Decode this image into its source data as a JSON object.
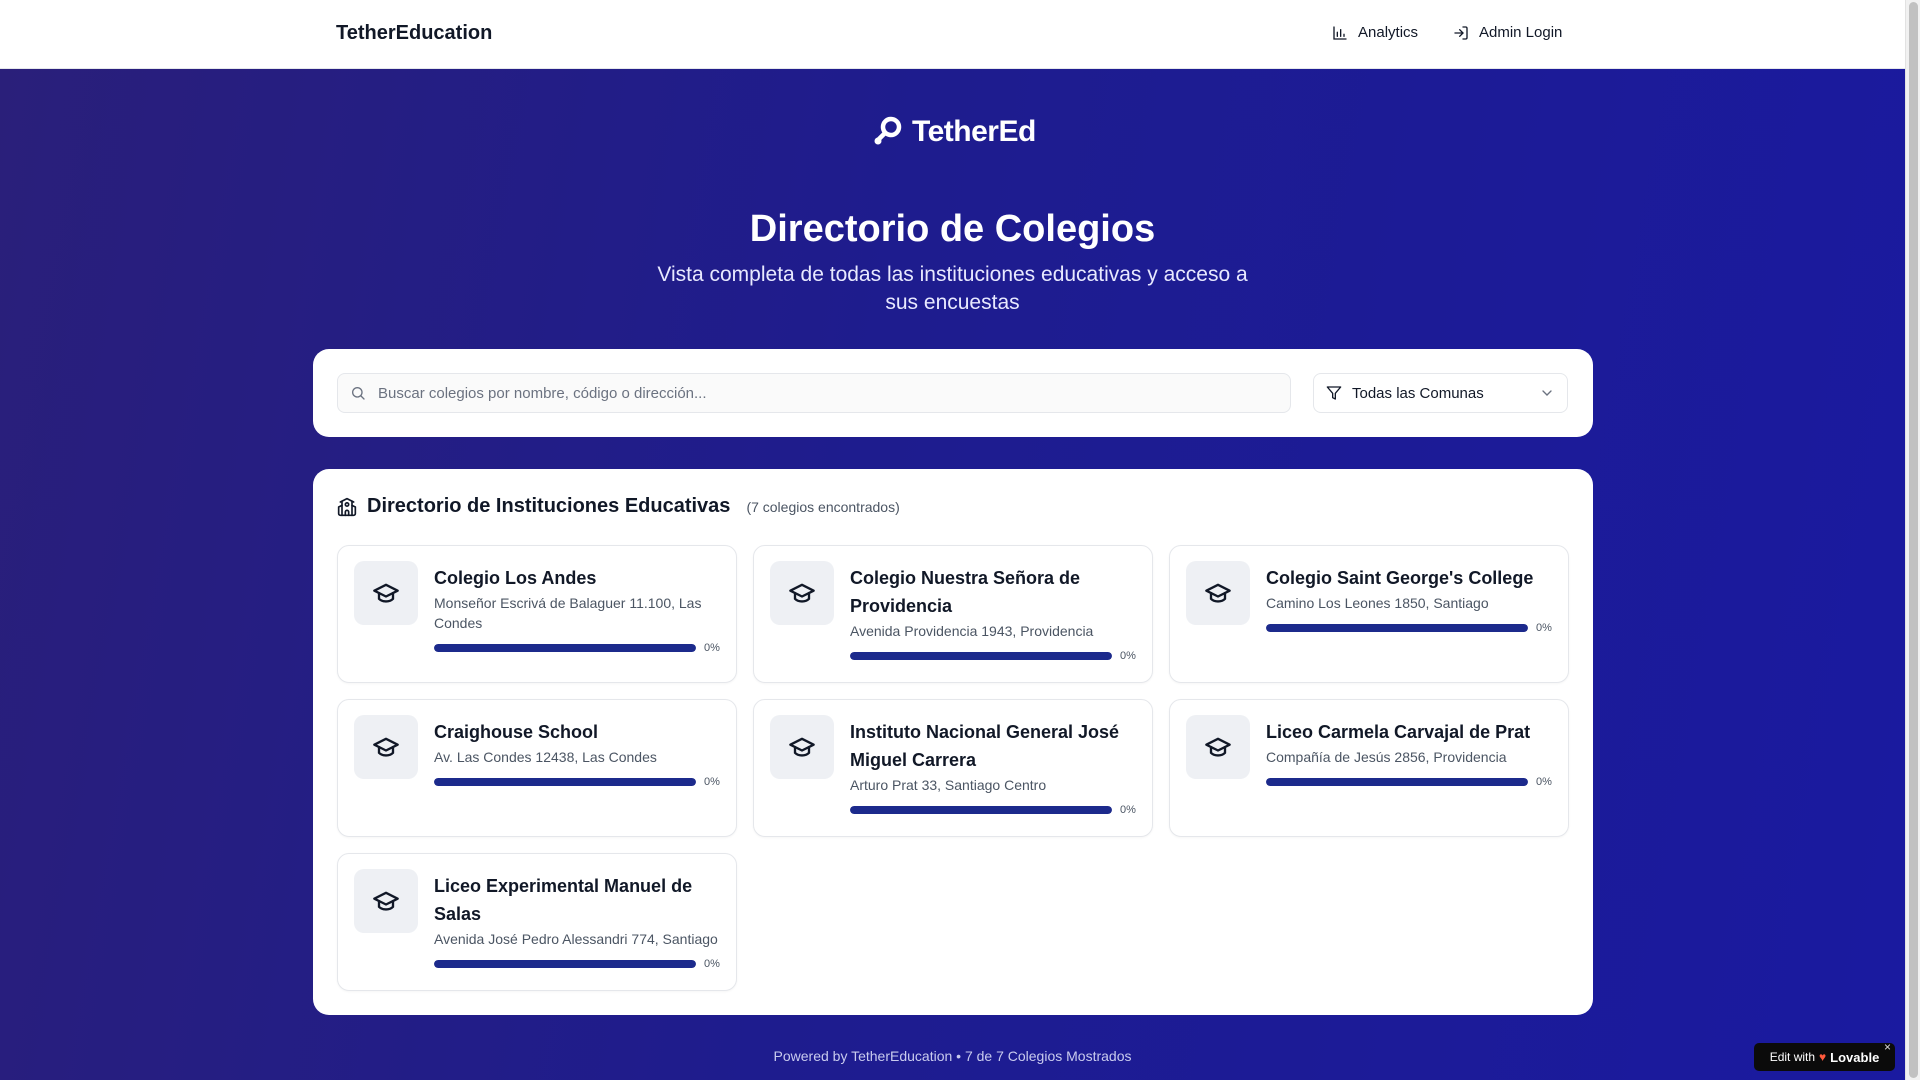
{
  "nav": {
    "brand": "TetherEducation",
    "analytics_label": "Analytics",
    "admin_label": "Admin Login"
  },
  "hero": {
    "logo_text": "TetherEd",
    "title": "Directorio de Colegios",
    "subtitle": "Vista completa de todas las instituciones educativas y acceso a sus encuestas"
  },
  "search": {
    "placeholder": "Buscar colegios por nombre, código o dirección...",
    "value": "",
    "filter_selected": "Todas las Comunas"
  },
  "directory": {
    "title": "Directorio de Instituciones Educativas",
    "count_text": "(7 colegios encontrados)",
    "schools": [
      {
        "name": "Colegio Los Andes",
        "address": "Monseñor Escrivá de Balaguer 11.100, Las Condes",
        "progress": 100,
        "progress_label": "0%"
      },
      {
        "name": "Colegio Nuestra Señora de Providencia",
        "address": "Avenida Providencia 1943, Providencia",
        "progress": 100,
        "progress_label": "0%"
      },
      {
        "name": "Colegio Saint George's College",
        "address": "Camino Los Leones 1850, Santiago",
        "progress": 100,
        "progress_label": "0%"
      },
      {
        "name": "Craighouse School",
        "address": "Av. Las Condes 12438, Las Condes",
        "progress": 100,
        "progress_label": "0%"
      },
      {
        "name": "Instituto Nacional General José Miguel Carrera",
        "address": "Arturo Prat 33, Santiago Centro",
        "progress": 100,
        "progress_label": "0%"
      },
      {
        "name": "Liceo Carmela Carvajal de Prat",
        "address": "Compañía de Jesús 2856, Providencia",
        "progress": 100,
        "progress_label": "0%"
      },
      {
        "name": "Liceo Experimental Manuel de Salas",
        "address": "Avenida José Pedro Alessandri 774, Santiago",
        "progress": 100,
        "progress_label": "0%"
      }
    ]
  },
  "footer": {
    "text": "Powered by TetherEducation • 7 de 7 Colegios Mostrados"
  },
  "badge": {
    "prefix": "Edit with",
    "brand": "Lovable",
    "close": "×"
  },
  "colors": {
    "primary": "#1c2a8c",
    "background_start": "#2a1f7a",
    "background_end": "#1a1aa0"
  }
}
